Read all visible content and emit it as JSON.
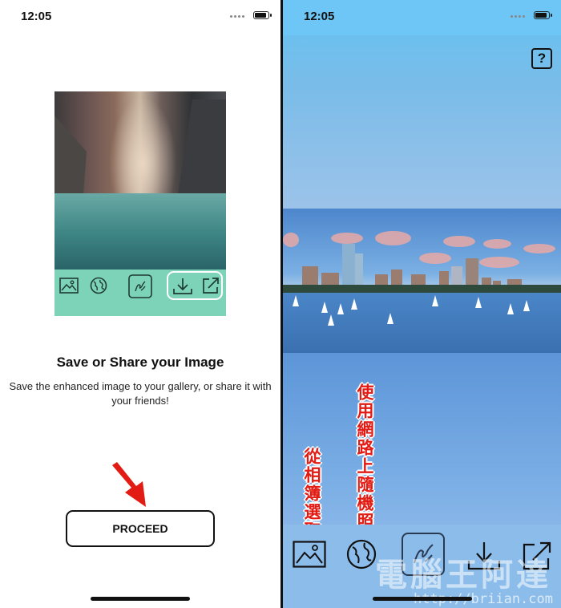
{
  "left_screen": {
    "status": {
      "time": "12:05"
    },
    "title": "Save or Share your Image",
    "description": "Save the enhanced image to your gallery, or share it with your friends!",
    "proceed_label": "PROCEED",
    "preview_toolbar_icons": [
      "gallery-icon",
      "globe-icon",
      "draw-icon",
      "download-icon",
      "share-icon"
    ]
  },
  "right_screen": {
    "status": {
      "time": "12:05"
    },
    "help_label": "?",
    "annotation_gallery": "從相簿選取",
    "annotation_web": "使用網路上隨機照片",
    "toolbar_icons": [
      "gallery-icon",
      "globe-icon",
      "draw-icon",
      "download-icon",
      "share-icon"
    ],
    "watermark": "電腦王阿達",
    "watermark_url": "http://briian.com"
  },
  "colors": {
    "accent_red": "#e21b14",
    "preview_toolbar": "#7cd3b8"
  }
}
